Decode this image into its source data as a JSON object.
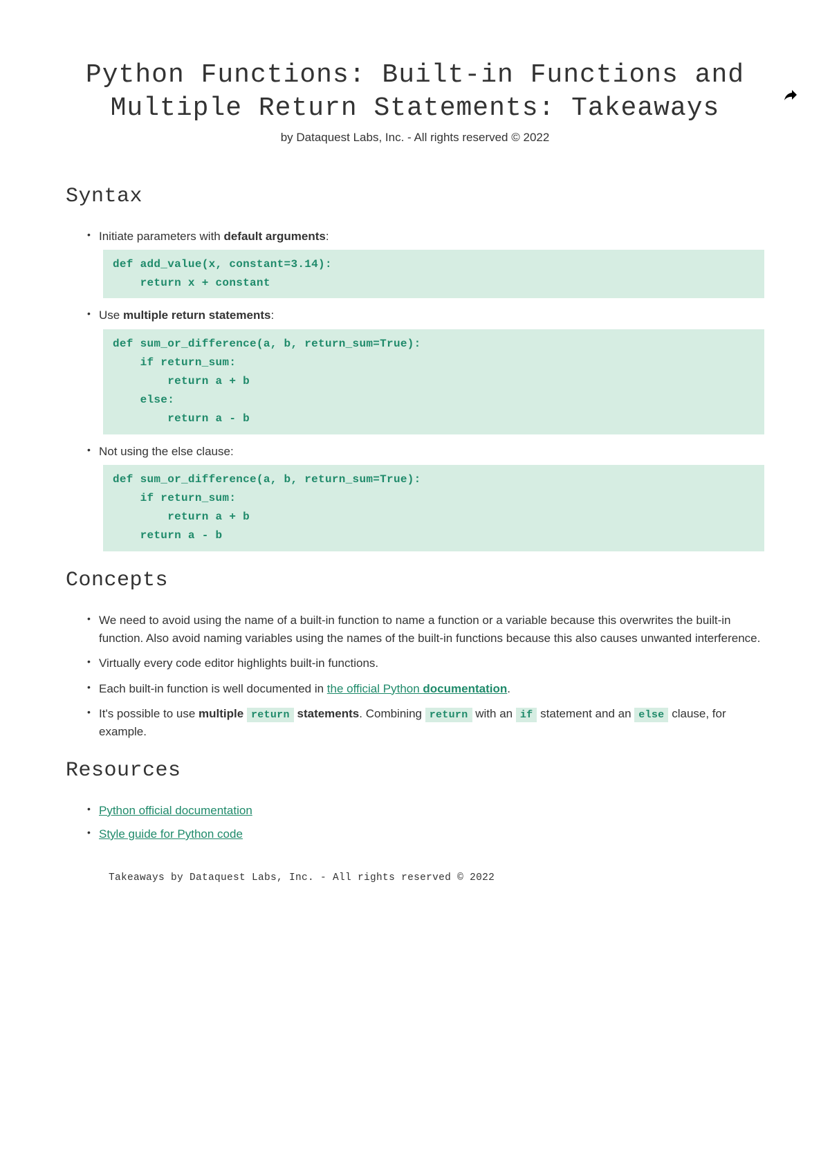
{
  "header": {
    "title": "Python Functions: Built-in Functions and Multiple Return Statements: Takeaways",
    "byline": "by Dataquest Labs, Inc. - All rights reserved © 2022"
  },
  "sections": {
    "syntax": {
      "heading": "Syntax",
      "items": [
        {
          "text_pre": "Initiate parameters with ",
          "bold": "default arguments",
          "text_post": ":",
          "code": "def add_value(x, constant=3.14):\n    return x + constant"
        },
        {
          "text_pre": "Use ",
          "bold": "multiple return statements",
          "text_post": ":",
          "code": "def sum_or_difference(a, b, return_sum=True):\n    if return_sum:\n        return a + b\n    else:\n        return a - b"
        },
        {
          "text_pre": "Not using the else clause:",
          "bold": "",
          "text_post": "",
          "code": "def sum_or_difference(a, b, return_sum=True):\n    if return_sum:\n        return a + b\n    return a - b"
        }
      ]
    },
    "concepts": {
      "heading": "Concepts",
      "item1": "We need to avoid using the name of a built-in function to name a function or a variable because this overwrites the built-in function. Also avoid naming variables using the names of the built-in functions because this also causes unwanted interference.",
      "item2": "Virtually every code editor highlights built-in functions.",
      "item3_pre": "Each built-in function is well documented in ",
      "item3_link_pre": "the official Python ",
      "item3_link_bold": "documentation",
      "item3_post": ".",
      "item4_a": "It's possible to use ",
      "item4_b": "multiple",
      "item4_c": "return",
      "item4_d": "statements",
      "item4_e": ". Combining ",
      "item4_f": "return",
      "item4_g": " with an ",
      "item4_h": "if",
      "item4_i": " statement and an ",
      "item4_j": "else",
      "item4_k": " clause, for example."
    },
    "resources": {
      "heading": "Resources",
      "links": [
        "Python official documentation",
        "Style guide for Python code"
      ]
    }
  },
  "footer": "Takeaways by Dataquest Labs, Inc. - All rights reserved © 2022"
}
